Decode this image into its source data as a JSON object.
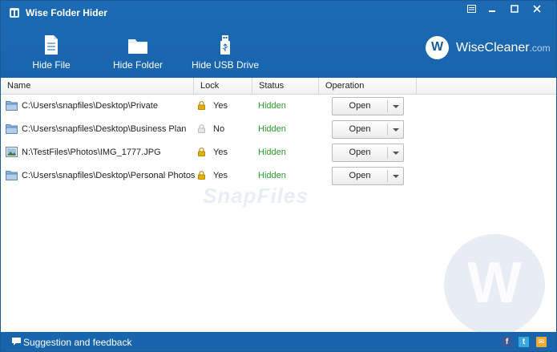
{
  "app": {
    "title": "Wise Folder Hider"
  },
  "toolbar": {
    "hide_file": "Hide File",
    "hide_folder": "Hide Folder",
    "hide_usb": "Hide USB Drive"
  },
  "brand": {
    "name": "WiseCleaner",
    "domain": ".com",
    "logo_letter": "W"
  },
  "columns": {
    "name": "Name",
    "lock": "Lock",
    "status": "Status",
    "operation": "Operation"
  },
  "rows": [
    {
      "icon": "folder-icon",
      "path": "C:\\Users\\snapfiles\\Desktop\\Private",
      "locked": true,
      "lock": "Yes",
      "status": "Hidden",
      "operation": "Open"
    },
    {
      "icon": "folder-icon",
      "path": "C:\\Users\\snapfiles\\Desktop\\Business Plan",
      "locked": false,
      "lock": "No",
      "status": "Hidden",
      "operation": "Open"
    },
    {
      "icon": "image-file-icon",
      "path": "N:\\TestFiles\\Photos\\IMG_1777.JPG",
      "locked": true,
      "lock": "Yes",
      "status": "Hidden",
      "operation": "Open"
    },
    {
      "icon": "folder-icon",
      "path": "C:\\Users\\snapfiles\\Desktop\\Personal Photos",
      "locked": true,
      "lock": "Yes",
      "status": "Hidden",
      "operation": "Open"
    }
  ],
  "watermark": {
    "text": "SnapFiles",
    "letter": "W"
  },
  "footer": {
    "feedback": "Suggestion and feedback"
  },
  "social": {
    "facebook": "f",
    "twitter": "t",
    "email": "✉"
  },
  "colors": {
    "header": "#1865ad",
    "status_hidden": "#2a9a2a",
    "lock_gold": "#e2b100"
  }
}
